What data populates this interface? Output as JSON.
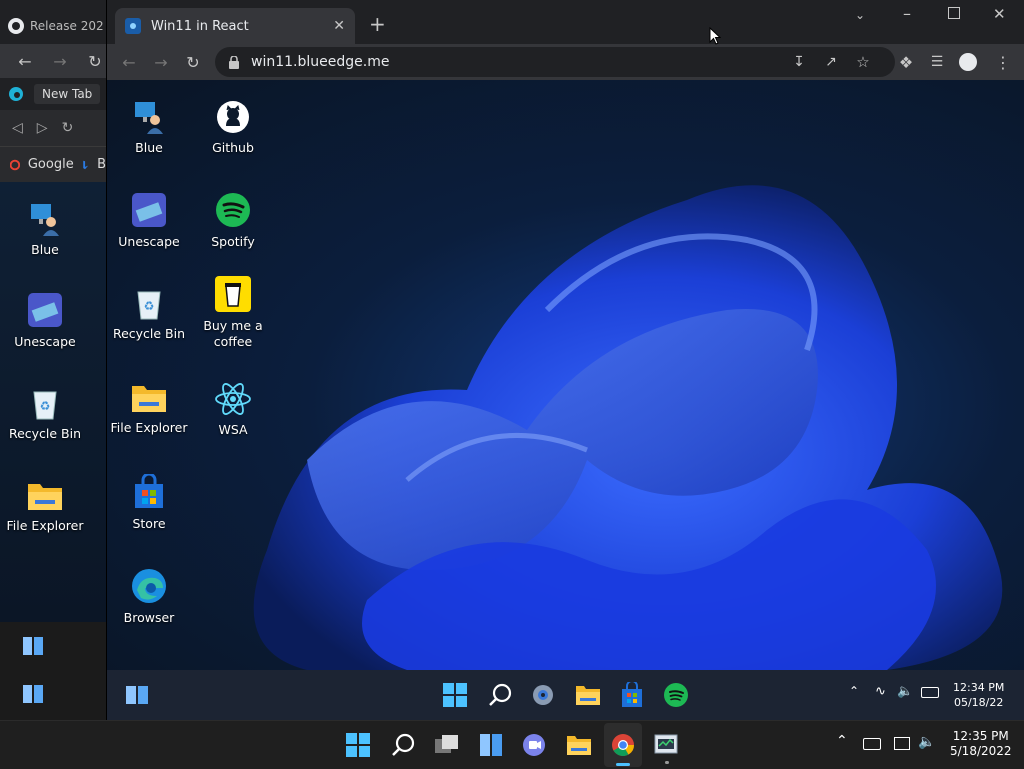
{
  "background_window": {
    "tab_title": "Release 202",
    "inner_tab_title": "New Tab",
    "bookmarks": [
      "Google",
      "B"
    ],
    "desktop_icons": [
      "Blue",
      "Unescape",
      "Recycle Bin",
      "File Explorer"
    ]
  },
  "main_window": {
    "tab_title": "Win11 in React",
    "url": "win11.blueedge.me",
    "desktop_icons_col1": [
      "Blue",
      "Unescape",
      "Recycle Bin",
      "File Explorer",
      "Store",
      "Browser"
    ],
    "desktop_icons_col2": [
      "Github",
      "Spotify",
      "Buy me a coffee",
      "WSA"
    ],
    "taskbar": {
      "time": "12:34 PM",
      "date": "05/18/22"
    }
  },
  "outer_taskbar": {
    "time": "12:35 PM",
    "date": "5/18/2022"
  },
  "colors": {
    "accent": "#1a73e8",
    "spotify": "#1db954",
    "coffee": "#ffdd00",
    "react": "#61dafb"
  }
}
